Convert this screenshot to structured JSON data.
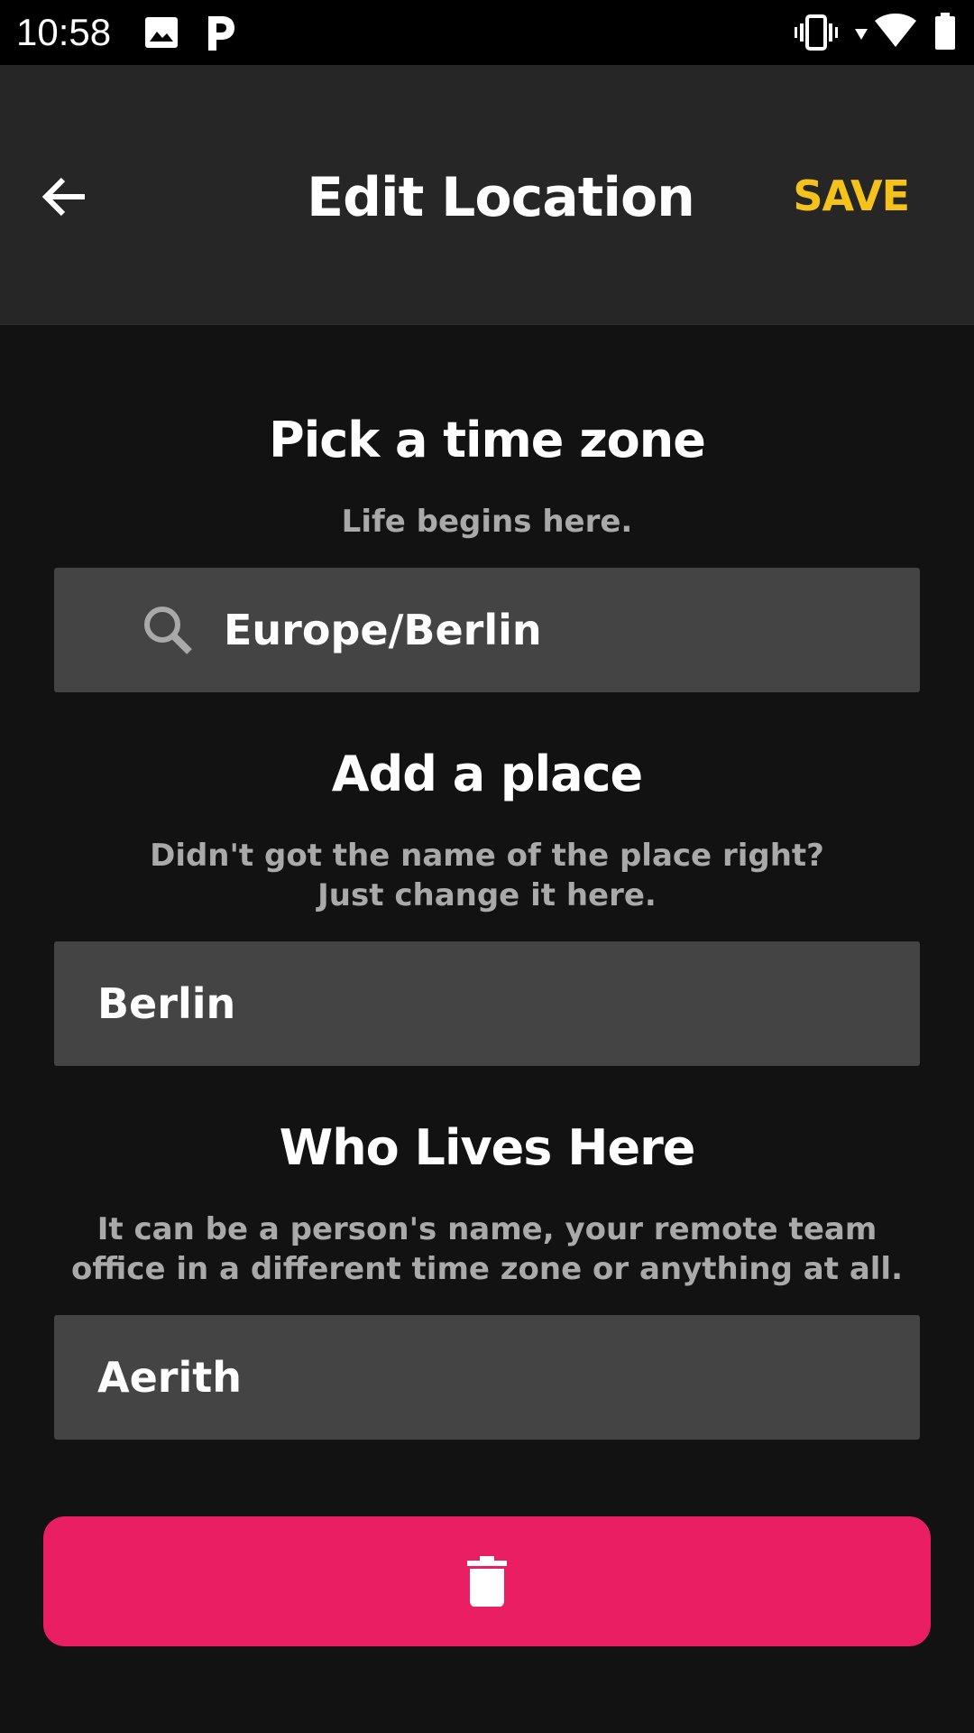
{
  "status_bar": {
    "time": "10:58",
    "icons": [
      "image-icon",
      "p-app-icon",
      "vibrate-icon",
      "wifi-icon",
      "battery-icon"
    ]
  },
  "app_bar": {
    "title": "Edit Location",
    "save_label": "SAVE",
    "back_icon": "arrow-left-icon",
    "accent_color": "#f5c21b"
  },
  "timezone_section": {
    "title": "Pick a time zone",
    "subtitle": "Life begins here.",
    "value": "Europe/Berlin",
    "icon": "search-icon"
  },
  "place_section": {
    "title": "Add a place",
    "subtitle_line1": "Didn't got the name of the place right?",
    "subtitle_line2": "Just change it here.",
    "value": "Berlin"
  },
  "who_section": {
    "title": "Who Lives Here",
    "subtitle_line1": "It can be a person's name, your remote team",
    "subtitle_line2": "office in a different time zone or anything at all.",
    "value": "Aerith"
  },
  "delete_button": {
    "icon": "trash-icon",
    "color": "#ea1e63"
  }
}
